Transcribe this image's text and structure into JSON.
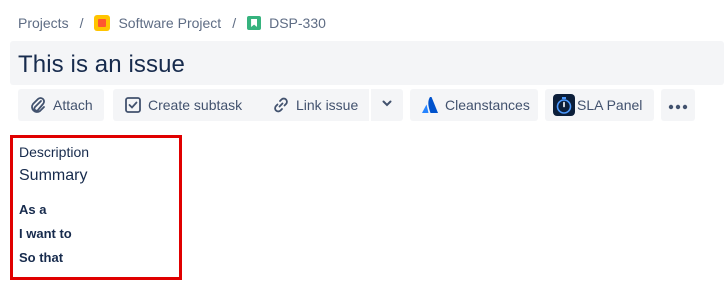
{
  "breadcrumb": {
    "projects": "Projects",
    "sep": "/",
    "project": "Software Project",
    "issue_key": "DSP-330"
  },
  "issue": {
    "title": "This is an issue"
  },
  "toolbar": {
    "attach_label": "Attach",
    "create_subtask_label": "Create subtask",
    "link_issue_label": "Link issue",
    "cleanstances_label": "Cleanstances",
    "sla_panel_label": "SLA Panel",
    "icons": [
      "paperclip-icon",
      "subtask-icon",
      "link-icon",
      "chevron-down-icon",
      "atlassian-icon",
      "stopwatch-icon",
      "more-icon"
    ]
  },
  "description": {
    "label": "Description",
    "summary": "Summary",
    "lines": [
      "As a",
      "I want to",
      "So that"
    ]
  },
  "colors": {
    "highlight_border": "#e00000",
    "text": "#172b4d",
    "button_bg": "#f4f5f7",
    "atlassian_blue": "#0052cc"
  }
}
